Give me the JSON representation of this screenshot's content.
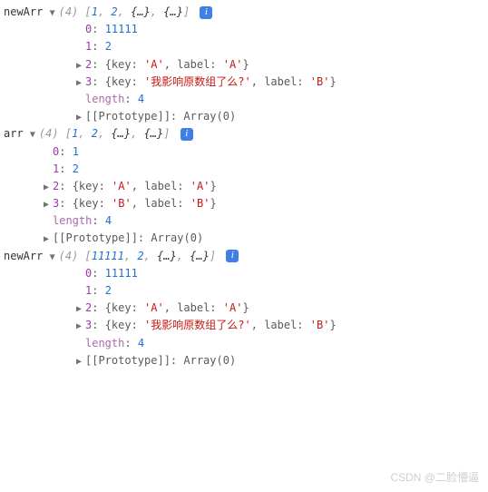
{
  "blocks": [
    {
      "name": "newArr",
      "indentCls": "ind2",
      "previewLen": "(4)",
      "previewItems": [
        {
          "type": "num",
          "v": "1"
        },
        {
          "type": "num",
          "v": "2"
        },
        {
          "type": "obj",
          "v": "{…}"
        },
        {
          "type": "obj",
          "v": "{…}"
        }
      ],
      "entries": [
        {
          "kind": "val",
          "k": "0",
          "v": "11111",
          "t": "num",
          "exp": false
        },
        {
          "kind": "val",
          "k": "1",
          "v": "2",
          "t": "num",
          "exp": false
        },
        {
          "kind": "obj",
          "k": "2",
          "pairs": [
            {
              "k": "key",
              "v": "'A'"
            },
            {
              "k": "label",
              "v": "'A'"
            }
          ]
        },
        {
          "kind": "obj",
          "k": "3",
          "pairs": [
            {
              "k": "key",
              "v": "'我影响原数组了么?'"
            },
            {
              "k": "label",
              "v": "'B'"
            }
          ]
        },
        {
          "kind": "len",
          "k": "length",
          "v": "4"
        },
        {
          "kind": "proto",
          "k": "[[Prototype]]",
          "v": "Array(0)"
        }
      ]
    },
    {
      "name": "arr",
      "indentCls": "ind1b",
      "previewLen": "(4)",
      "previewItems": [
        {
          "type": "num",
          "v": "1"
        },
        {
          "type": "num",
          "v": "2"
        },
        {
          "type": "obj",
          "v": "{…}"
        },
        {
          "type": "obj",
          "v": "{…}"
        }
      ],
      "entries": [
        {
          "kind": "val",
          "k": "0",
          "v": "1",
          "t": "num",
          "exp": false
        },
        {
          "kind": "val",
          "k": "1",
          "v": "2",
          "t": "num",
          "exp": false
        },
        {
          "kind": "obj",
          "k": "2",
          "pairs": [
            {
              "k": "key",
              "v": "'A'"
            },
            {
              "k": "label",
              "v": "'A'"
            }
          ]
        },
        {
          "kind": "obj",
          "k": "3",
          "pairs": [
            {
              "k": "key",
              "v": "'B'"
            },
            {
              "k": "label",
              "v": "'B'"
            }
          ]
        },
        {
          "kind": "len",
          "k": "length",
          "v": "4"
        },
        {
          "kind": "proto",
          "k": "[[Prototype]]",
          "v": "Array(0)"
        }
      ]
    },
    {
      "name": "newArr",
      "indentCls": "ind2",
      "previewLen": "(4)",
      "previewItems": [
        {
          "type": "num",
          "v": "11111"
        },
        {
          "type": "num",
          "v": "2"
        },
        {
          "type": "obj",
          "v": "{…}"
        },
        {
          "type": "obj",
          "v": "{…}"
        }
      ],
      "entries": [
        {
          "kind": "val",
          "k": "0",
          "v": "11111",
          "t": "num",
          "exp": false
        },
        {
          "kind": "val",
          "k": "1",
          "v": "2",
          "t": "num",
          "exp": false
        },
        {
          "kind": "obj",
          "k": "2",
          "pairs": [
            {
              "k": "key",
              "v": "'A'"
            },
            {
              "k": "label",
              "v": "'A'"
            }
          ]
        },
        {
          "kind": "obj",
          "k": "3",
          "pairs": [
            {
              "k": "key",
              "v": "'我影响原数组了么?'"
            },
            {
              "k": "label",
              "v": "'B'"
            }
          ]
        },
        {
          "kind": "len",
          "k": "length",
          "v": "4"
        },
        {
          "kind": "proto",
          "k": "[[Prototype]]",
          "v": "Array(0)"
        }
      ]
    }
  ],
  "watermark": "CSDN @二脸懵逼"
}
